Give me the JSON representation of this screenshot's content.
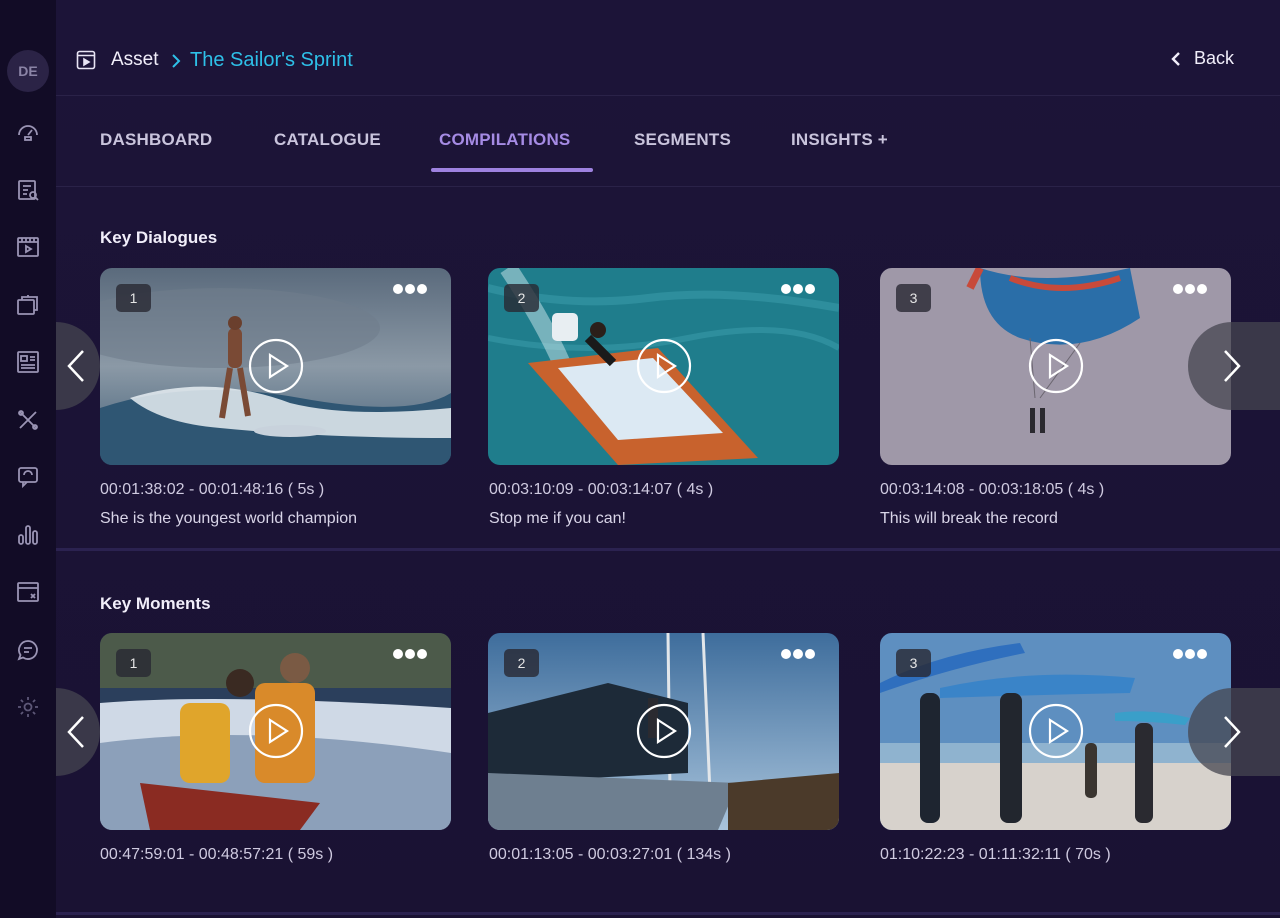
{
  "user": {
    "initials": "DE"
  },
  "breadcrumb": {
    "root": "Asset",
    "current": "The Sailor's Sprint"
  },
  "back_label": "Back",
  "tabs": [
    {
      "label": "DASHBOARD"
    },
    {
      "label": "CATALOGUE"
    },
    {
      "label": "COMPILATIONS",
      "active": true
    },
    {
      "label": "SEGMENTS"
    },
    {
      "label": "INSIGHTS +"
    }
  ],
  "sidebar_icons": [
    "dashboard-gauge-icon",
    "catalogue-search-icon",
    "video-player-icon",
    "folders-icon",
    "layout-grid-icon",
    "tools-icon",
    "speech-bubble-icon",
    "bar-chart-icon",
    "browser-window-icon",
    "chat-icon",
    "settings-gear-icon"
  ],
  "sections": [
    {
      "title": "Key Dialogues",
      "cards": [
        {
          "number": "1",
          "time": "00:01:38:02 - 00:01:48:16 ( 5s )",
          "caption": "She is the youngest world champion",
          "scene": "surfer-wave"
        },
        {
          "number": "2",
          "time": "00:03:10:09 - 00:03:14:07 ( 4s )",
          "caption": "Stop me if you can!",
          "scene": "speedboat"
        },
        {
          "number": "3",
          "time": "00:03:14:08 - 00:03:18:05 ( 4s )",
          "caption": "This will break the record",
          "scene": "parasail"
        }
      ]
    },
    {
      "title": "Key Moments",
      "cards": [
        {
          "number": "1",
          "time": "00:47:59:01 - 00:48:57:21 ( 59s )",
          "caption": "",
          "scene": "canoe"
        },
        {
          "number": "2",
          "time": "00:01:13:05 - 00:03:27:01 ( 134s )",
          "caption": "",
          "scene": "sailboat"
        },
        {
          "number": "3",
          "time": "01:10:22:23 - 01:11:32:11 ( 70s )",
          "caption": "",
          "scene": "beach-surfers"
        }
      ]
    }
  ],
  "colors": {
    "accent": "#a58be4",
    "link": "#2ec0e8",
    "background": "#1a1233"
  }
}
